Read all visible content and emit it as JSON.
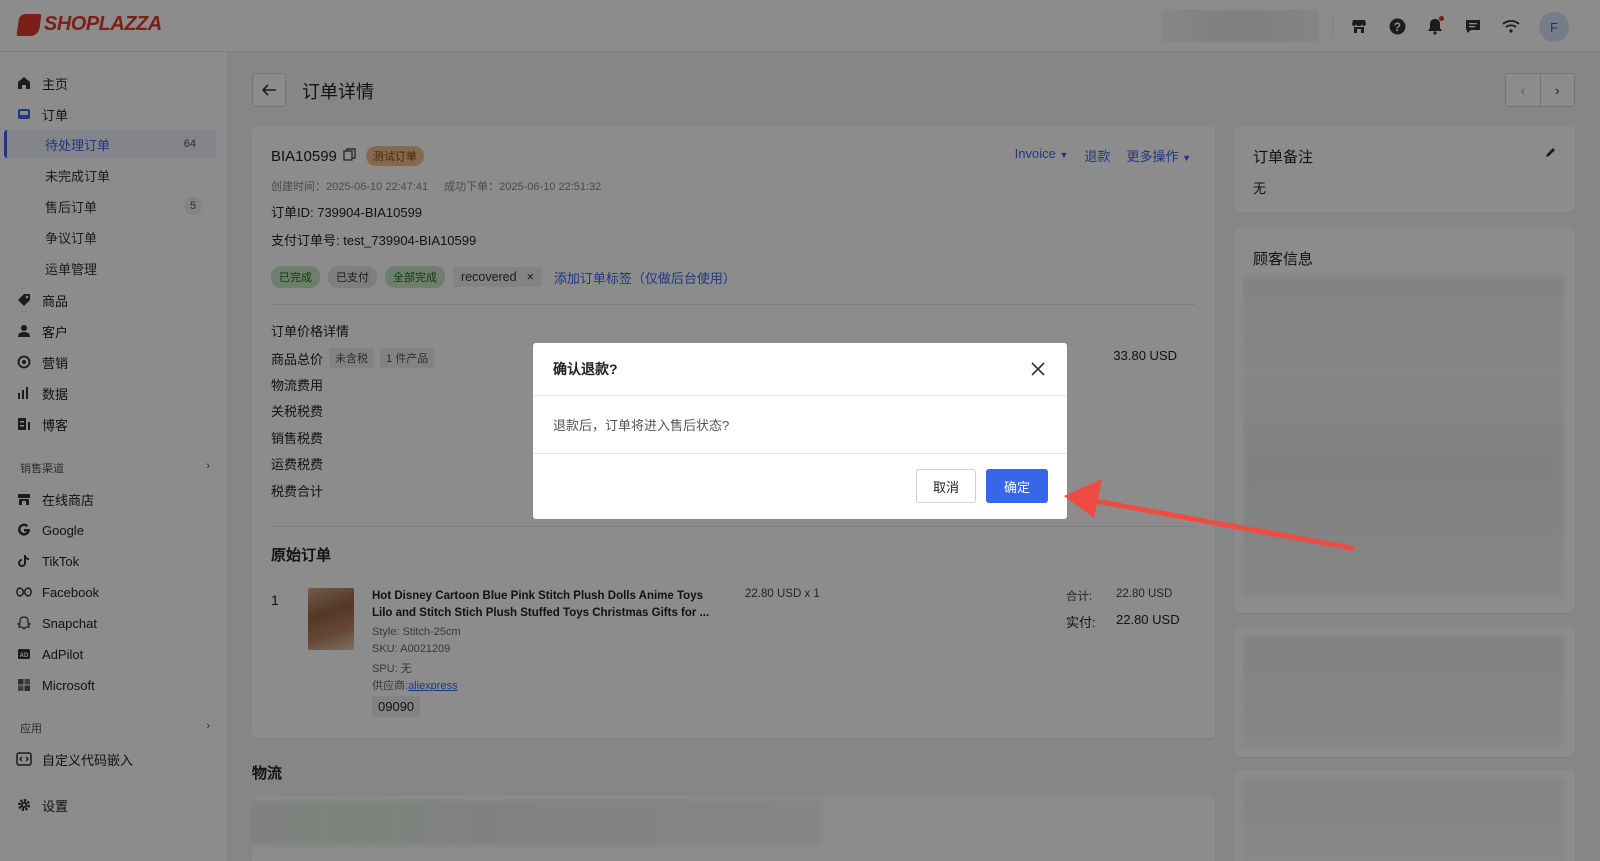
{
  "brand": "SHOPLAZZA",
  "topbar": {
    "avatar_letter": "F",
    "icons": [
      "store-icon",
      "help-icon",
      "bell-icon",
      "message-icon",
      "wifi-icon"
    ]
  },
  "sidebar": {
    "home": "主页",
    "orders": "订单",
    "order_sub": [
      {
        "label": "待处理订单",
        "badge": "64"
      },
      {
        "label": "未完成订单",
        "badge": ""
      },
      {
        "label": "售后订单",
        "badge": "5"
      },
      {
        "label": "争议订单",
        "badge": ""
      },
      {
        "label": "运单管理",
        "badge": ""
      }
    ],
    "products": "商品",
    "customers": "客户",
    "marketing": "营销",
    "analytics": "数据",
    "blog": "博客",
    "channels_label": "销售渠道",
    "channels": [
      "在线商店",
      "Google",
      "TikTok",
      "Facebook",
      "Snapchat",
      "AdPilot",
      "Microsoft"
    ],
    "apps_label": "应用",
    "custom_code": "自定义代码嵌入",
    "settings": "设置"
  },
  "page": {
    "title": "订单详情"
  },
  "order": {
    "number": "BIA10599",
    "test_tag": "测试订单",
    "actions": {
      "invoice": "Invoice",
      "refund": "退款",
      "more": "更多操作"
    },
    "created": "创建时间：2025-06-10 22:47:41",
    "placed": "成功下单：2025-06-10 22:51:32",
    "order_id": "订单ID: 739904-BIA10599",
    "payment_no": "支付订单号: test_739904-BIA10599",
    "status_tags": [
      "已完成",
      "已支付",
      "全部完成"
    ],
    "custom_tag": "recovered",
    "add_tag": "添加订单标签（仅做后台使用）",
    "price_title": "订单价格详情",
    "price_rows": [
      {
        "label": "商品总价",
        "pills": [
          "未含税",
          "1 件产品"
        ],
        "value": "33.80 USD"
      },
      {
        "label": "物流费用",
        "pills": [],
        "value": ""
      },
      {
        "label": "关税税费",
        "pills": [],
        "value": ""
      },
      {
        "label": "销售税费",
        "pills": [],
        "value": ""
      },
      {
        "label": "运费税费",
        "pills": [],
        "value": ""
      },
      {
        "label": "税费合计",
        "pills": [],
        "value": ""
      }
    ],
    "original_title": "原始订单",
    "item": {
      "index": "1",
      "title": "Hot Disney Cartoon Blue Pink Stitch Plush Dolls Anime Toys Lilo and Stitch Stich Plush Stuffed Toys Christmas Gifts for ...",
      "price_qty": "22.80 USD x 1",
      "style": "Style: Stitch-25cm",
      "sku": "SKU: A0021209",
      "spu": "SPU: 无",
      "supplier_label": "供应商:",
      "supplier": "aliexpress",
      "sku_code": "09090",
      "subtotal_label": "合计:",
      "subtotal": "22.80 USD",
      "paid_label": "实付:",
      "paid": "22.80 USD"
    }
  },
  "notes": {
    "title": "订单备注",
    "value": "无"
  },
  "customer": {
    "title": "顾客信息"
  },
  "logistics": {
    "title": "物流"
  },
  "modal": {
    "title": "确认退款?",
    "body": "退款后，订单将进入售后状态?",
    "cancel": "取消",
    "confirm": "确定"
  },
  "colors": {
    "accent": "#3766e8",
    "brand": "#e23a2e",
    "annotation_arrow": "#ef4b45"
  }
}
